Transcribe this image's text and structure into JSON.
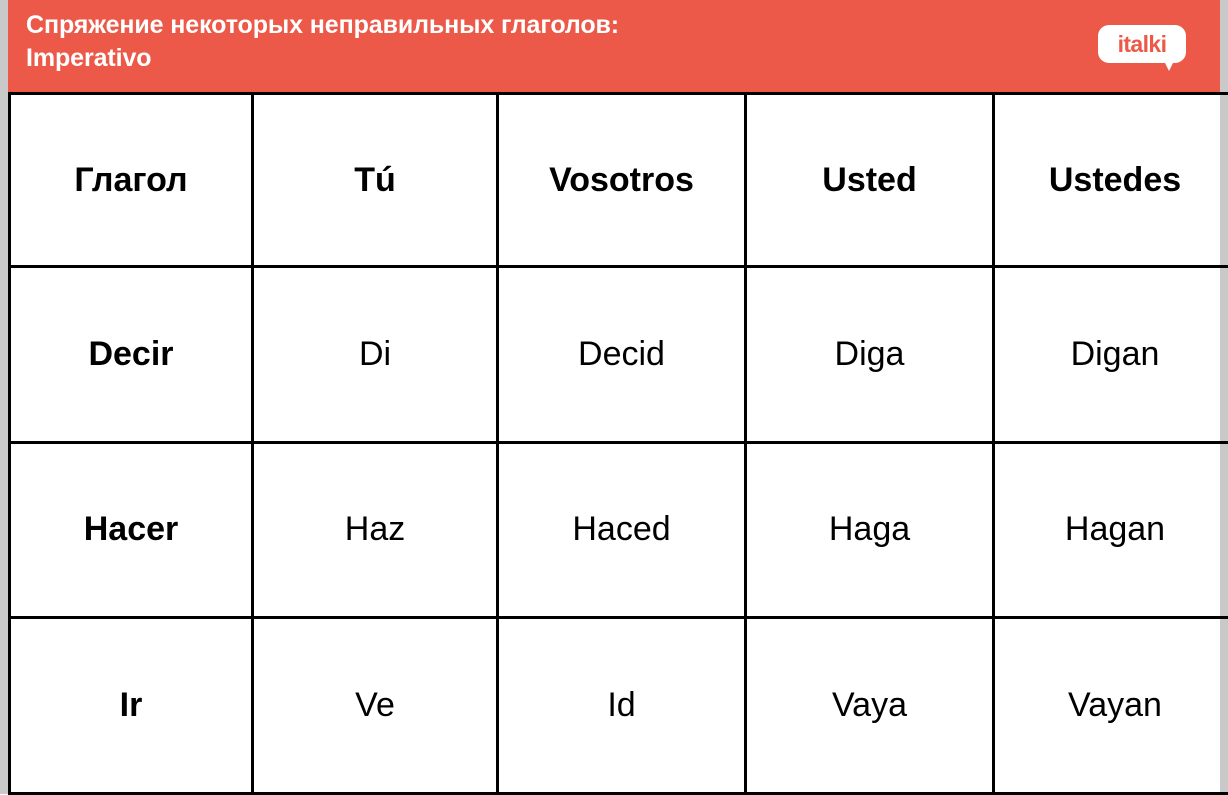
{
  "banner": {
    "title": "Спряжение некоторых неправильных глаголов:\nImperativo",
    "title_line1": "Спряжение некоторых неправильных глаголов:",
    "title_line2": "Imperativo",
    "background_color": "#ec5948",
    "text_color": "#ffffff"
  },
  "logo": {
    "name": "italki",
    "text": "italki",
    "text_color": "#ec5948",
    "bubble_color": "#ffffff"
  },
  "table": {
    "headers": [
      "Глагол",
      "Tú",
      "Vosotros",
      "Usted",
      "Ustedes"
    ],
    "rows": [
      {
        "verb": "Decir",
        "tu": "Di",
        "vosotros": "Decid",
        "usted": "Diga",
        "ustedes": "Digan"
      },
      {
        "verb": "Hacer",
        "tu": "Haz",
        "vosotros": "Haced",
        "usted": "Haga",
        "ustedes": "Hagan"
      },
      {
        "verb": "Ir",
        "tu": "Ve",
        "vosotros": "Id",
        "usted": "Vaya",
        "ustedes": "Vayan"
      }
    ],
    "border_color": "#000000",
    "cell_background": "#ffffff"
  }
}
